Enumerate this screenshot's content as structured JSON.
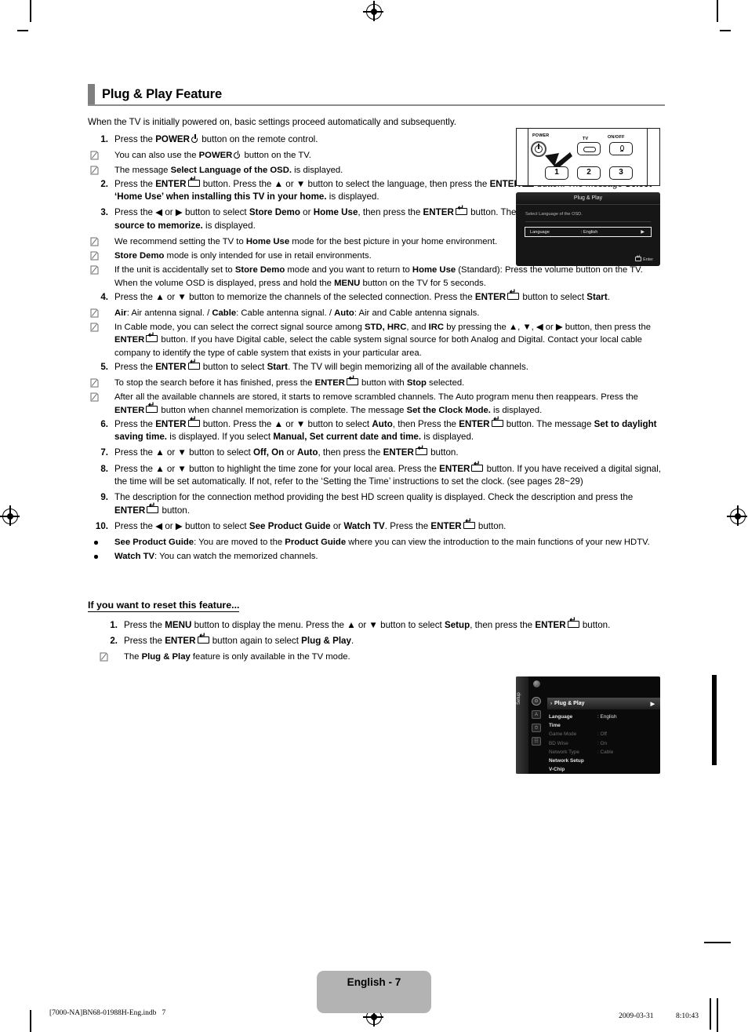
{
  "document": {
    "section_title": "Plug & Play Feature",
    "intro": "When the TV is initially powered on, basic settings proceed automatically and subsequently."
  },
  "steps": [
    {
      "num": "1.",
      "html": "Press the <b>POWER</b><span class='pwr'></span> button on the remote control.",
      "children": [
        {
          "kind": "note",
          "html": "You can also use the <b>POWER</b><span class='pwr'></span> button on the TV."
        },
        {
          "kind": "note",
          "html": "The message <b>Select Language of the OSD.</b> is displayed."
        }
      ]
    },
    {
      "num": "2.",
      "html": "Press the <b>ENTER</b><span class='kbd-enter'></span> button. Press the ▲ or ▼ button to select the language, then press the <b>ENTER</b><span class='kbd-enter'></span> button. The message <b>Select ‘Home Use’ when installing this TV in your home.</b> is displayed.",
      "children": []
    },
    {
      "num": "3.",
      "html": "Press the ◀ or ▶ button to select <b>Store Demo</b> or <b>Home Use</b>, then press the <b>ENTER</b><span class='kbd-enter'></span> button. The message <b>Select the Antenna source to memorize.</b> is displayed.",
      "children": [
        {
          "kind": "note",
          "html": "We recommend setting the TV to <b>Home Use</b> mode for the best picture in your home environment."
        },
        {
          "kind": "note",
          "html": "<b>Store Demo</b> mode is only intended for use in retail environments."
        },
        {
          "kind": "note",
          "html": "If the unit is accidentally set to <b>Store Demo</b> mode and you want to return to <b>Home Use</b> (Standard): Press the volume button on the TV. When the volume OSD is displayed, press and hold the <b>MENU</b> button on the TV for 5 seconds."
        }
      ]
    },
    {
      "num": "4.",
      "html": "Press the ▲ or ▼ button to memorize the channels of the selected connection. Press the <b>ENTER</b><span class='kbd-enter'></span> button to select <b>Start</b>.",
      "children": [
        {
          "kind": "note",
          "html": "<b>Air</b>: Air antenna signal. / <b>Cable</b>: Cable antenna signal. / <b>Auto</b>: Air and Cable antenna signals."
        },
        {
          "kind": "note",
          "html": "In Cable mode, you can select the correct signal source among <b>STD, HRC</b>, and <b>IRC</b> by pressing the ▲, ▼, ◀ or ▶ button, then press the <b>ENTER</b><span class='kbd-enter'></span> button. If you have Digital cable, select the cable system signal source for both Analog and Digital. Contact your local cable company to identify the type of cable system that exists in your particular area."
        }
      ]
    },
    {
      "num": "5.",
      "html": "Press the <b>ENTER</b><span class='kbd-enter'></span> button to select <b>Start</b>. The TV will begin memorizing all of the available channels.",
      "children": [
        {
          "kind": "note",
          "html": "To stop the search before it has finished, press the <b>ENTER</b><span class='kbd-enter'></span> button with <b>Stop</b> selected."
        },
        {
          "kind": "note",
          "html": "After all the available channels are stored, it starts to remove scrambled channels. The Auto program menu then reappears. Press the <b>ENTER</b><span class='kbd-enter'></span> button when channel memorization is complete. The message <b>Set the Clock Mode.</b> is displayed."
        }
      ]
    },
    {
      "num": "6.",
      "html": "Press the <b>ENTER</b><span class='kbd-enter'></span> button. Press the ▲ or ▼ button to select <b>Auto</b>, then Press the <b>ENTER</b><span class='kbd-enter'></span> button. The message <b>Set to daylight saving time.</b> is displayed. If you select <b>Manual, Set current date and time.</b> is displayed.",
      "children": []
    },
    {
      "num": "7.",
      "html": "Press the ▲ or ▼ button to select <b>Off, On</b> or <b>Auto</b>, then press the <b>ENTER</b><span class='kbd-enter'></span> button.",
      "children": []
    },
    {
      "num": "8.",
      "html": "Press the ▲ or ▼ button to highlight the time zone for your local area. Press the <b>ENTER</b><span class='kbd-enter'></span> button. If you have received a digital signal, the time will be set automatically. If not, refer to the ‘Setting the Time’ instructions to set the clock. (see pages 28~29)",
      "children": []
    },
    {
      "num": "9.",
      "html": "The description for the connection method providing the best HD screen quality is displayed. Check the description and press the <b>ENTER</b><span class='kbd-enter'></span> button.",
      "children": []
    },
    {
      "num": "10.",
      "html": "Press the ◀ or ▶ button to select <b>See Product Guide</b> or <b>Watch TV</b>. Press the <b>ENTER</b><span class='kbd-enter'></span> button.",
      "children": [
        {
          "kind": "bullet",
          "html": "<b>See Product Guide</b>: You are moved to the <b>Product Guide</b> where you can view the introduction to the main functions of your new HDTV."
        },
        {
          "kind": "bullet",
          "html": "<b>Watch TV</b>: You can watch the memorized channels."
        }
      ]
    }
  ],
  "reset_section": {
    "title": "If you want to reset this feature...",
    "steps": [
      {
        "num": "1.",
        "html": "Press the <b>MENU</b> button to display the menu. Press the ▲ or ▼ button to select <b>Setup</b>, then press the <b>ENTER</b><span class='kbd-enter'></span> button.",
        "children": []
      },
      {
        "num": "2.",
        "html": "Press the <b>ENTER</b><span class='kbd-enter'></span> button again to select <b>Plug & Play</b>.",
        "children": [
          {
            "kind": "note",
            "html": "The <b>Plug & Play</b> feature is only available in the TV mode."
          }
        ]
      }
    ]
  },
  "figures": {
    "remote": {
      "labels": {
        "power": "POWER",
        "tv": "TV",
        "onoff": "ON/OFF"
      },
      "numbers": [
        "1",
        "2",
        "3"
      ]
    },
    "osd_plug_play": {
      "title": "Plug & Play",
      "message": "Select Language of the OSD.",
      "row_label": "Language",
      "row_value": ": English",
      "row_arrow": "▶",
      "footer": "Enter"
    },
    "osd_setup_menu": {
      "rail_label": "Setup",
      "selected_item": "Plug & Play",
      "selected_caret": "›",
      "selected_arrow": "▶",
      "items": [
        {
          "name": "Language",
          "value": ": English",
          "state": "bold"
        },
        {
          "name": "Time",
          "value": "",
          "state": "bold"
        },
        {
          "name": "Game Mode",
          "value": ": Off",
          "state": "dim"
        },
        {
          "name": "BD Wise",
          "value": ": On",
          "state": "dim"
        },
        {
          "name": "Network Type",
          "value": ": Cable",
          "state": "dim"
        },
        {
          "name": "Network Setup",
          "value": "",
          "state": "bold"
        },
        {
          "name": "V-Chip",
          "value": "",
          "state": "bold"
        }
      ]
    }
  },
  "footer": {
    "page_badge": "English - 7",
    "left": "[7000-NA]BN68-01988H-Eng.indb   7",
    "right": "2009-03-31   　　 8:10:43"
  }
}
